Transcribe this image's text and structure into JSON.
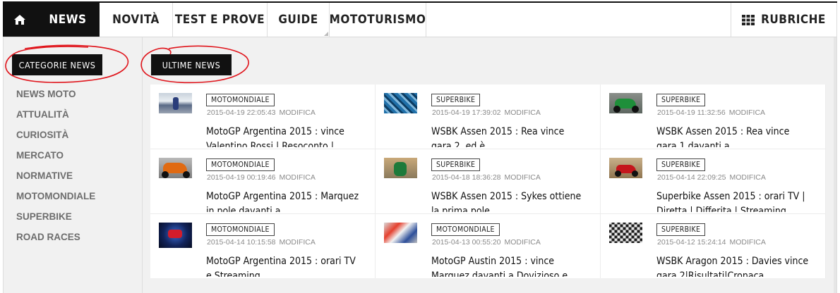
{
  "nav": {
    "news": "NEWS",
    "novita": "NOVITÀ",
    "test": "TEST E PROVE",
    "guide": "GUIDE",
    "mototurismo": "MOTOTURISMO",
    "rubriche": "RUBRICHE"
  },
  "sidebar": {
    "heading": "CATEGORIE NEWS",
    "items": [
      {
        "label": "NEWS MOTO"
      },
      {
        "label": "ATTUALITÀ"
      },
      {
        "label": "CURIOSITÀ"
      },
      {
        "label": "MERCATO"
      },
      {
        "label": "NORMATIVE"
      },
      {
        "label": "MOTOMONDIALE"
      },
      {
        "label": "SUPERBIKE"
      },
      {
        "label": "ROAD RACES"
      }
    ]
  },
  "latest": {
    "heading": "ULTIME NEWS",
    "edit_label": "MODIFICA",
    "articles": [
      {
        "category": "MOTOMONDIALE",
        "datetime": "2015-04-19 22:05:43",
        "title": "MotoGP Argentina 2015 : vince Valentino Rossi | Resoconto |",
        "thumb": "rider-celebrating-photo"
      },
      {
        "category": "SUPERBIKE",
        "datetime": "2015-04-19 17:39:02",
        "title": "WSBK Assen 2015 : Rea vince gara 2, ed è",
        "thumb": "crowd-celebration-photo"
      },
      {
        "category": "SUPERBIKE",
        "datetime": "2015-04-19 11:32:56",
        "title": "WSBK Assen 2015 : Rea vince gara 1 davanti a",
        "thumb": "green-superbike-photo"
      },
      {
        "category": "MOTOMONDIALE",
        "datetime": "2015-04-19 00:19:46",
        "title": "MotoGP Argentina 2015 : Marquez in pole davanti a",
        "thumb": "orange-motogp-bike-photo"
      },
      {
        "category": "SUPERBIKE",
        "datetime": "2015-04-18 18:36:28",
        "title": "WSBK Assen 2015 : Sykes ottiene la prima pole",
        "thumb": "superbike-track-photo"
      },
      {
        "category": "SUPERBIKE",
        "datetime": "2015-04-14 22:09:25",
        "title": "Superbike Assen 2015 : orari TV | Diretta | Differita | Streaming",
        "thumb": "red-superbike-photo"
      },
      {
        "category": "MOTOMONDIALE",
        "datetime": "2015-04-14 10:15:58",
        "title": "MotoGP Argentina 2015 : orari TV e Streaming",
        "thumb": "red-bull-grand-prix-logo"
      },
      {
        "category": "MOTOMONDIALE",
        "datetime": "2015-04-13 00:55:20",
        "title": "MotoGP Austin 2015 : vince Marquez davanti a Dovizioso e",
        "thumb": "podium-riders-photo"
      },
      {
        "category": "SUPERBIKE",
        "datetime": "2015-04-12 15:24:14",
        "title": "WSBK Aragon 2015 : Davies vince gara 2|Risultati|Cronaca",
        "thumb": "checkered-flag-photo"
      }
    ]
  },
  "colors": {
    "nav_active_bg": "#111111",
    "annotation_red": "#e0141b",
    "category_text": "#6d6d6d"
  }
}
